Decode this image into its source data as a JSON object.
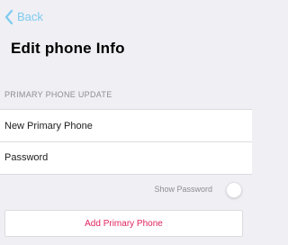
{
  "nav": {
    "back_label": "Back",
    "back_icon": "chevron-left-icon",
    "accent_color": "#7ecbef"
  },
  "page": {
    "title": "Edit phone Info"
  },
  "form": {
    "section_header": "PRIMARY PHONE UPDATE",
    "fields": [
      {
        "name": "new-primary-phone",
        "placeholder": "New Primary Phone",
        "value": ""
      },
      {
        "name": "password",
        "placeholder": "Password",
        "value": ""
      }
    ],
    "show_password_label": "Show Password",
    "show_password_enabled": false
  },
  "actions": {
    "add_primary_phone_label": "Add Primary Phone",
    "add_button_color": "#e0245e"
  }
}
